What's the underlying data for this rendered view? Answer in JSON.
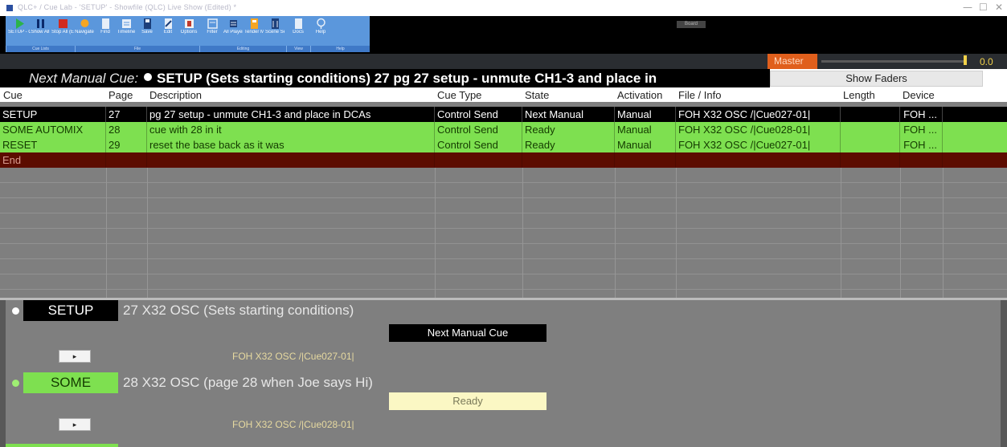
{
  "window": {
    "title": "QLC+ / Cue Lab - 'SETUP' - Showfile (QLC) Live Show (Edited) *",
    "controls": [
      "—",
      "☐",
      "✕"
    ]
  },
  "ribbon": {
    "tools": [
      {
        "label": "SETUP - Go (Space)",
        "icon": "go-icon",
        "color": "#2bb34a"
      },
      {
        "label": "Show All",
        "icon": "show-all-icon",
        "color": "#0b2a6b"
      },
      {
        "label": "Stop All (Esc)",
        "icon": "stop-icon",
        "color": "#d12a1f"
      },
      {
        "label": "Navigate",
        "icon": "navigate-icon",
        "color": "#f5a623"
      },
      {
        "label": "Find",
        "icon": "find-icon",
        "color": "#e6eef8"
      },
      {
        "label": "Timeline",
        "icon": "timeline-icon",
        "color": "#e6eef8"
      },
      {
        "label": "Save",
        "icon": "save-icon",
        "color": "#1c3f7a"
      },
      {
        "label": "Edit",
        "icon": "edit-icon",
        "color": "#e6eef8"
      },
      {
        "label": "Options",
        "icon": "options-icon",
        "color": "#f2f2f2"
      },
      {
        "label": "Filter",
        "icon": "filter-icon",
        "color": "#e6eef8"
      },
      {
        "label": "All Players",
        "icon": "players-icon",
        "color": "#1c3f7a"
      },
      {
        "label": "Tender Map",
        "icon": "map-icon",
        "color": "#f5a623"
      },
      {
        "label": "Scene Settings",
        "icon": "settings-icon",
        "color": "#1c3f7a"
      },
      {
        "label": "Docs",
        "icon": "docs-icon",
        "color": "#e6eef8"
      },
      {
        "label": "Help",
        "icon": "help-icon",
        "color": "#e6eef8"
      }
    ],
    "groups": [
      {
        "label": "Cue Lists"
      },
      {
        "label": "File"
      },
      {
        "label": "Editing"
      },
      {
        "label": "View"
      },
      {
        "label": "Help"
      }
    ],
    "right_label": "Board"
  },
  "master": {
    "label": "Master",
    "value": "0.0",
    "fader_level": 1.0
  },
  "next_manual_cue": {
    "label": "Next Manual Cue:",
    "text": "SETUP (Sets starting conditions) 27  pg 27 setup - unmute CH1-3 and place in"
  },
  "show_faders": "Show Faders",
  "table": {
    "columns": [
      "Cue",
      "Page",
      "Description",
      "Cue Type",
      "State",
      "Activation",
      "File / Info",
      "Length",
      "Device"
    ],
    "rows": [
      {
        "cue": "SETUP",
        "page": "27",
        "description": "pg 27 setup - unmute CH1-3 and place in DCAs",
        "cue_type": "Control Send",
        "state": "Next Manual",
        "activation": "Manual",
        "file": "FOH X32 OSC /|Cue027-01|",
        "length": "",
        "device": "FOH ..."
      },
      {
        "cue": "SOME AUTOMIX",
        "page": "28",
        "description": "cue with 28 in it",
        "cue_type": "Control Send",
        "state": "Ready",
        "activation": "Manual",
        "file": "FOH X32 OSC /|Cue028-01|",
        "length": "",
        "device": "FOH ..."
      },
      {
        "cue": "RESET",
        "page": "29",
        "description": "reset the base back as it was",
        "cue_type": "Control Send",
        "state": "Ready",
        "activation": "Manual",
        "file": "FOH X32 OSC /|Cue027-01|",
        "length": "",
        "device": "FOH ..."
      },
      {
        "cue": "End",
        "page": "",
        "description": "",
        "cue_type": "",
        "state": "",
        "activation": "",
        "file": "",
        "length": "",
        "device": ""
      }
    ]
  },
  "cue_panels": [
    {
      "name": "SETUP",
      "description": "27  X32 OSC  (Sets starting conditions)",
      "state": "Next Manual Cue",
      "play": "▸",
      "file": "FOH X32 OSC /|Cue027-01|"
    },
    {
      "name": "SOME",
      "description": "28  X32 OSC  (page 28 when Joe says Hi)",
      "state": "Ready",
      "play": "▸",
      "file": "FOH X32 OSC /|Cue028-01|"
    }
  ],
  "colors": {
    "ribbon_blue": "#5b97dc",
    "ready_green": "#7ee050",
    "end_red": "#5c0c00",
    "master_orange": "#e05f1c",
    "fader_yellow": "#f2d24a",
    "ready_box": "#fbf7c4"
  }
}
